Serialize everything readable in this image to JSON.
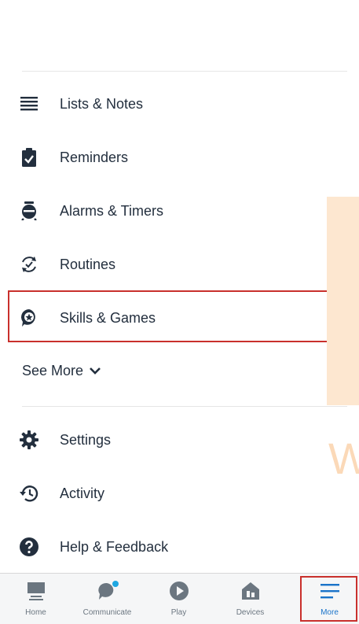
{
  "menu": {
    "items": [
      {
        "label": "Lists & Notes",
        "icon": "list-icon"
      },
      {
        "label": "Reminders",
        "icon": "clipboard-check-icon"
      },
      {
        "label": "Alarms & Timers",
        "icon": "alarm-clock-icon"
      },
      {
        "label": "Routines",
        "icon": "routines-icon"
      },
      {
        "label": "Skills & Games",
        "icon": "skills-icon"
      }
    ],
    "see_more": "See More",
    "secondary": [
      {
        "label": "Settings",
        "icon": "gear-icon"
      },
      {
        "label": "Activity",
        "icon": "history-icon"
      },
      {
        "label": "Help & Feedback",
        "icon": "help-icon"
      }
    ]
  },
  "watermark": {
    "letter": "W"
  },
  "bottom_nav": {
    "tabs": [
      {
        "label": "Home",
        "icon": "home-icon"
      },
      {
        "label": "Communicate",
        "icon": "chat-icon"
      },
      {
        "label": "Play",
        "icon": "play-icon"
      },
      {
        "label": "Devices",
        "icon": "devices-icon"
      },
      {
        "label": "More",
        "icon": "menu-icon",
        "active": true
      }
    ]
  },
  "colors": {
    "accent": "#1a73c9",
    "highlight": "#c9302c",
    "text": "#232f3e",
    "notification": "#1ea7e1"
  }
}
